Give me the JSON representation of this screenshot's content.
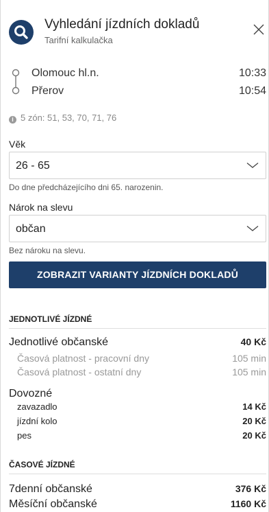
{
  "header": {
    "title": "Vyhledání jízdních dokladů",
    "subtitle": "Tarifní kalkulačka"
  },
  "route": {
    "from": {
      "station": "Olomouc hl.n.",
      "time": "10:33"
    },
    "to": {
      "station": "Přerov",
      "time": "10:54"
    }
  },
  "zones": "5 zón: 51, 53, 70, 71, 76",
  "age": {
    "label": "Věk",
    "value": "26 - 65",
    "hint": "Do dne předcházejícího dni 65. narozenin."
  },
  "discount": {
    "label": "Nárok na slevu",
    "value": "občan",
    "hint": "Bez nároku na slevu."
  },
  "show_button": "ZOBRAZIT VARIANTY JÍZDNÍCH DOKLADŮ",
  "single": {
    "heading": "JEDNOTLIVÉ JÍZDNÉ",
    "ticket": {
      "name": "Jednotlivé občanské",
      "price": "40 Kč"
    },
    "validity": [
      {
        "label": "Časová platnost - pracovní dny",
        "value": "105 min"
      },
      {
        "label": "Časová platnost - ostatní dny",
        "value": "105 min"
      }
    ],
    "luggage_heading": "Dovozné",
    "luggage": [
      {
        "label": "zavazadlo",
        "price": "14 Kč"
      },
      {
        "label": "jízdní kolo",
        "price": "20 Kč"
      },
      {
        "label": "pes",
        "price": "20 Kč"
      }
    ]
  },
  "periodic": {
    "heading": "ČASOVÉ JÍZDNÉ",
    "items": [
      {
        "name": "7denní občanské",
        "price": "376 Kč"
      },
      {
        "name": "Měsíční občanské",
        "price": "1160 Kč"
      }
    ]
  },
  "colors": {
    "brand": "#1e3f6a",
    "muted": "#999999"
  },
  "icons": [
    "search-icon",
    "close-icon",
    "route-icon",
    "info-icon",
    "chevron-down-icon"
  ]
}
